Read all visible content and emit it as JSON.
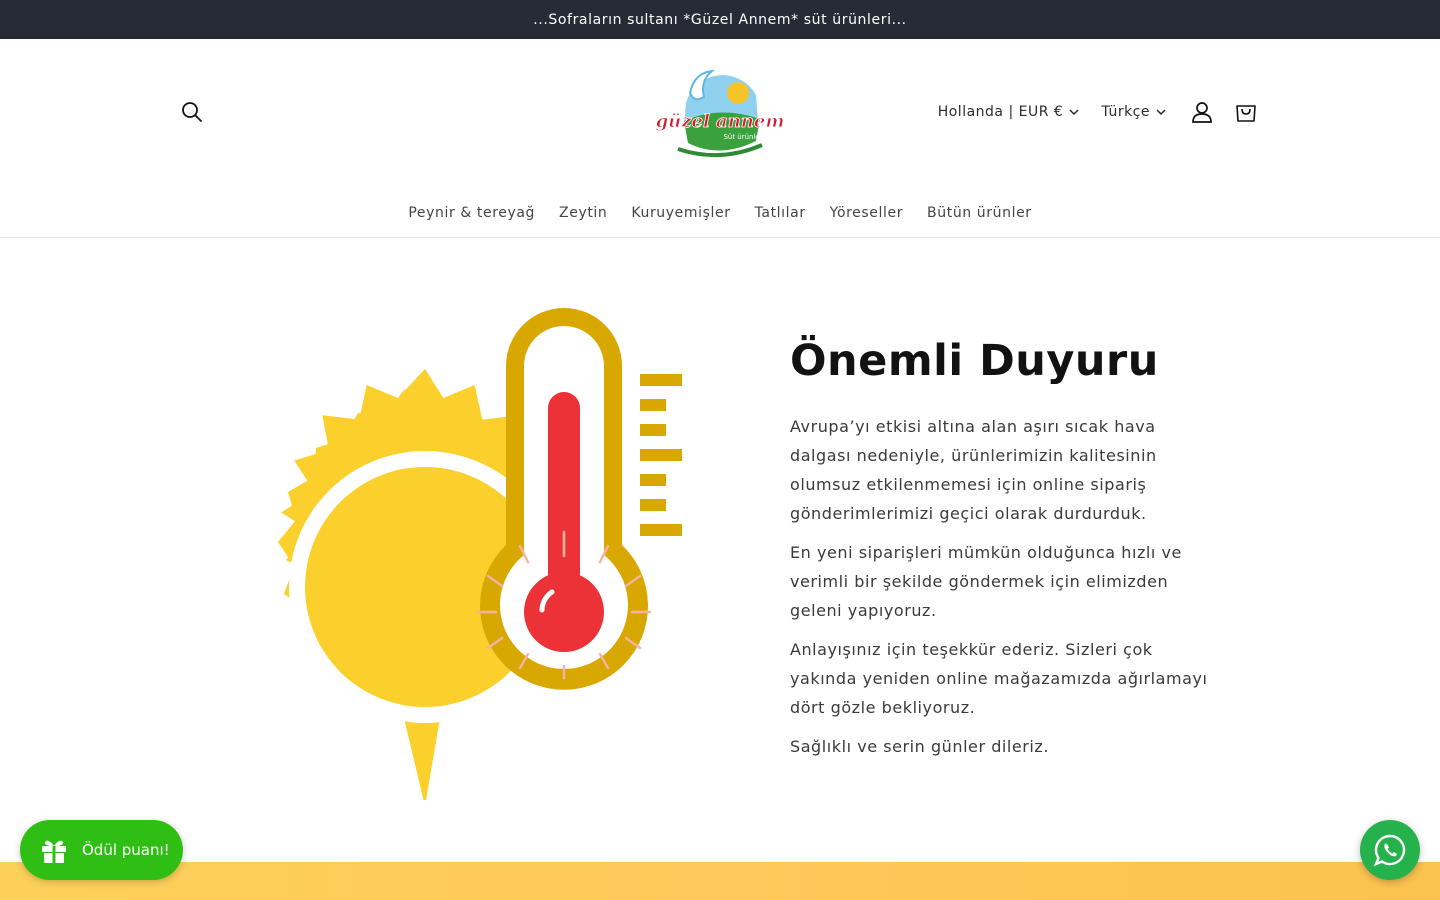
{
  "announcement": {
    "text": "...Sofraların sultanı *Güzel Annem* süt ürünleri..."
  },
  "header": {
    "logo": {
      "brand_text": "güzel annem",
      "tagline": "Süt ürünleri"
    },
    "country_selector": {
      "label": "Hollanda | EUR €"
    },
    "language_selector": {
      "label": "Türkçe"
    },
    "icons": {
      "search": "search-icon",
      "account": "account-icon",
      "cart": "cart-icon"
    }
  },
  "nav": {
    "items": [
      {
        "label": "Peynir & tereyağ"
      },
      {
        "label": "Zeytin"
      },
      {
        "label": "Kuruyemişler"
      },
      {
        "label": "Tatlılar"
      },
      {
        "label": "Yöreseller"
      },
      {
        "label": "Bütün ürünler"
      }
    ]
  },
  "main": {
    "title": "Önemli Duyuru",
    "paragraphs": [
      "Avrupa’yı etkisi altına alan aşırı sıcak hava dalgası nedeniyle, ürünlerimizin kalitesinin olumsuz etkilenmemesi için online sipariş gönderimlerimizi geçici olarak durdurduk.",
      "En yeni siparişleri mümkün olduğunca hızlı ve verimli bir şekilde göndermek için elimizden geleni yapıyoruz.",
      "Anlayışınız için teşekkür ederiz. Sizleri çok yakında yeniden online mağazamızda ağırlamayı dört gözle bekliyoruz.",
      "Sağlıklı ve serin günler dileriz."
    ]
  },
  "floating": {
    "rewards": {
      "label": "Ödül puanı!",
      "icon": "gift-icon"
    },
    "whatsapp": {
      "icon": "whatsapp-icon"
    }
  },
  "colors": {
    "announcement_bg": "#272b35",
    "sun_yellow": "#fcd02c",
    "thermometer_gold": "#d9a800",
    "thermometer_red": "#ec3237",
    "rewards_green": "#2fbf14",
    "whatsapp_green": "#25b14c"
  }
}
